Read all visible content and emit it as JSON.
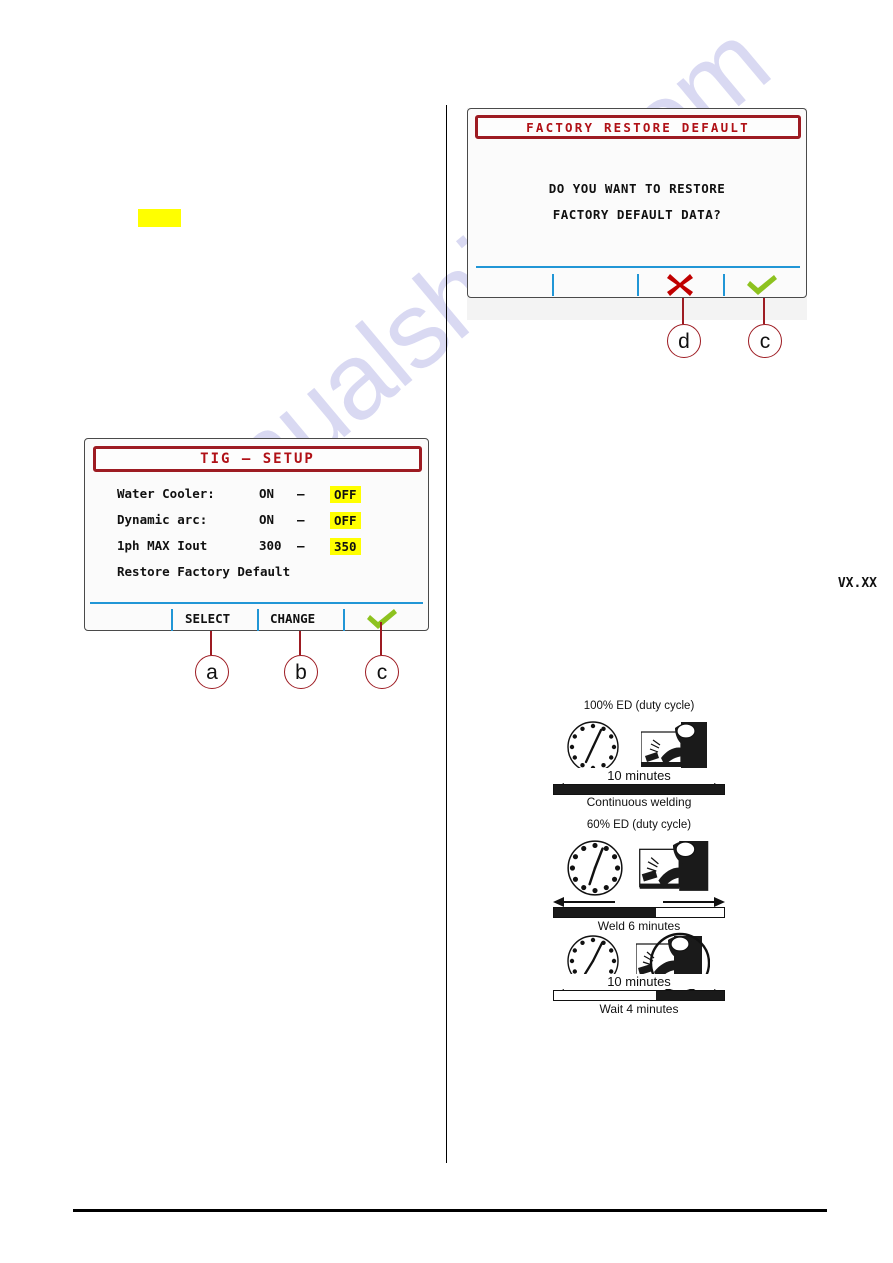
{
  "watermark": {
    "text": "manualshive.com"
  },
  "tig_setup_panel": {
    "title": "TIG – SETUP",
    "rows": [
      {
        "label": "Water Cooler:",
        "option_a": "ON",
        "separator": "–",
        "option_b": "OFF",
        "highlighted": "OFF",
        "has_arrow": true
      },
      {
        "label": "Dynamic arc:",
        "option_a": "ON",
        "separator": "–",
        "option_b": "OFF",
        "highlighted": "OFF",
        "has_arrow": false
      },
      {
        "label": "1ph MAX  Iout",
        "option_a": "300",
        "separator": "–",
        "option_b": "350",
        "highlighted": "350",
        "has_arrow": false
      }
    ],
    "menu_line": "Restore Factory Default",
    "version": "VX.XX",
    "softkeys": [
      {
        "label": "SELECT",
        "icon": ""
      },
      {
        "label": "CHANGE",
        "icon": ""
      },
      {
        "label": "",
        "icon": "check-icon"
      }
    ],
    "callouts": [
      {
        "letter": "a",
        "target": "SELECT"
      },
      {
        "letter": "b",
        "target": "CHANGE"
      },
      {
        "letter": "c",
        "target": "confirm"
      }
    ]
  },
  "factory_restore_panel": {
    "title": "FACTORY RESTORE DEFAULT",
    "message_line_1": "DO YOU WANT TO RESTORE",
    "message_line_2": "FACTORY DEFAULT DATA?",
    "softkeys": [
      {
        "label": "",
        "icon": ""
      },
      {
        "label": "",
        "icon": ""
      },
      {
        "label": "",
        "icon": "cross-icon"
      },
      {
        "label": "",
        "icon": "check-icon"
      }
    ],
    "callouts": [
      {
        "letter": "d",
        "target": "cancel"
      },
      {
        "letter": "c",
        "target": "confirm"
      }
    ]
  },
  "duty_cycle": {
    "blocks": [
      {
        "heading": "100% ED  (duty cycle)",
        "span_label": "10 minutes",
        "caption": "Continuous welding",
        "fill_percent": 100,
        "fill_side": "left",
        "arrow_style": "full",
        "clock_icon": "clock-icon",
        "welder_icon": "welder-icon"
      },
      {
        "heading": "60% ED  (duty cycle)",
        "span_label": "",
        "caption": "Weld 6 minutes",
        "fill_percent": 60,
        "fill_side": "left",
        "arrow_style": "split",
        "clock_icon": "clock-icon",
        "welder_icon": "welder-icon"
      },
      {
        "heading": "",
        "span_label": "10 minutes",
        "caption": "Wait 4 minutes",
        "fill_percent": 60,
        "fill_side": "right",
        "arrow_style": "full",
        "clock_icon": "clock-icon",
        "welder_icon": "welder-waiting-icon"
      }
    ]
  },
  "colors": {
    "title_red": "#b01117",
    "border_red": "#9d1b22",
    "highlight_yellow": "#ffff00",
    "separator_blue": "#2196d6",
    "check_green": "#8dc21f",
    "cross_red": "#c00000",
    "watermark": "#d9d9f2"
  }
}
